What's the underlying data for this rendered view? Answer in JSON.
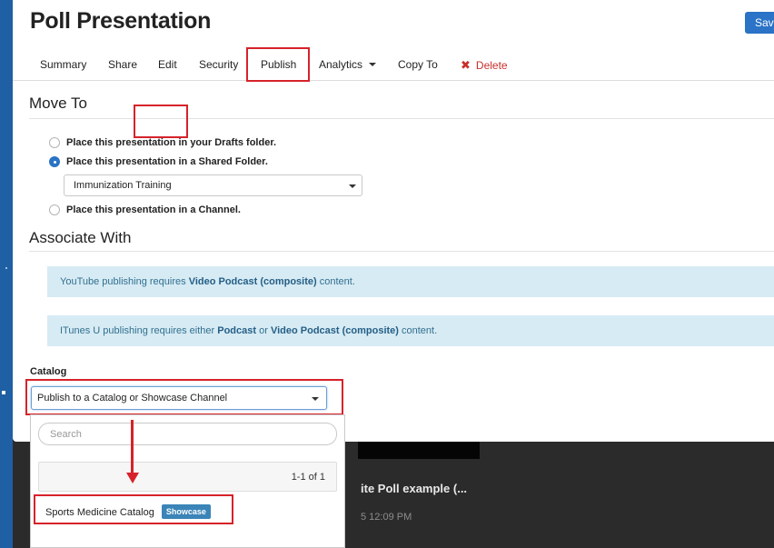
{
  "page": {
    "title": "Poll Presentation",
    "save_label": "Save"
  },
  "tabs": {
    "summary": "Summary",
    "share": "Share",
    "edit": "Edit",
    "security": "Security",
    "publish": "Publish",
    "analytics": "Analytics",
    "copy_to": "Copy To",
    "delete": "Delete"
  },
  "move_to": {
    "title": "Move To",
    "options": [
      {
        "label": "Place this presentation in your Drafts folder.",
        "checked": false
      },
      {
        "label": "Place this presentation in a Shared Folder.",
        "checked": true
      },
      {
        "label": "Place this presentation in a Channel.",
        "checked": false
      }
    ],
    "folder_selected": "Immunization Training"
  },
  "associate_with": {
    "title": "Associate With",
    "youtube_alert": {
      "pre": "YouTube publishing requires ",
      "bold": "Video Podcast (composite)",
      "post": " content."
    },
    "itunes_alert": {
      "pre": "ITunes U publishing requires either ",
      "bold1": "Podcast",
      "mid": " or ",
      "bold2": "Video Podcast (composite)",
      "post": " content."
    }
  },
  "catalog": {
    "label": "Catalog",
    "selected": "Publish to a Catalog or Showcase Channel",
    "search_placeholder": "Search",
    "pager": "1-1 of 1",
    "results": [
      {
        "name": "Sports Medicine Catalog",
        "badge": "Showcase"
      }
    ]
  },
  "background": {
    "row_title": "ite Poll example (...",
    "row_date": "5 12:09 PM"
  },
  "colors": {
    "accent": "#2a73c6",
    "annotation_red": "#d6222a",
    "alert_bg": "#d7ebf4",
    "delete_red": "#c9302c"
  },
  "icons": {
    "delete": "x-icon",
    "dropdown": "caret-down-icon"
  }
}
